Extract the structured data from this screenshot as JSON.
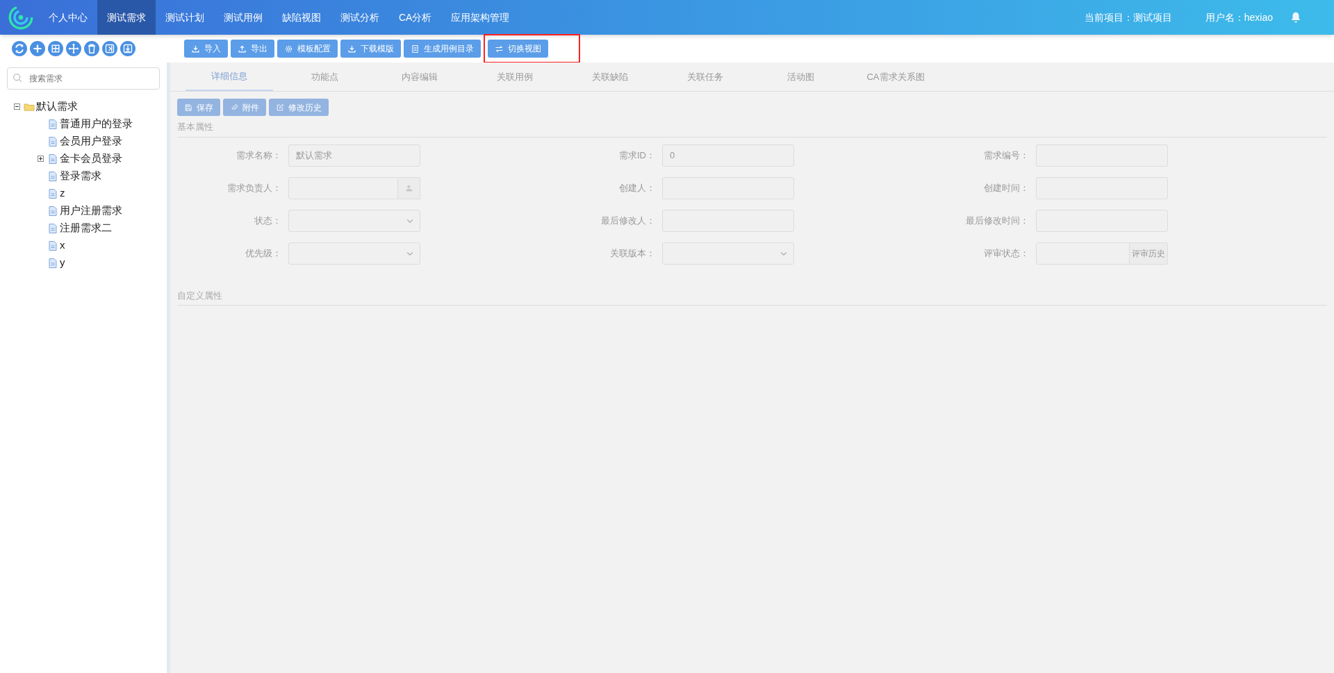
{
  "nav": {
    "items": [
      {
        "label": "个人中心",
        "selected": false
      },
      {
        "label": "测试需求",
        "selected": true
      },
      {
        "label": "测试计划",
        "selected": false
      },
      {
        "label": "测试用例",
        "selected": false
      },
      {
        "label": "缺陷视图",
        "selected": false
      },
      {
        "label": "测试分析",
        "selected": false
      },
      {
        "label": "CA分析",
        "selected": false
      },
      {
        "label": "应用架构管理",
        "selected": false
      }
    ],
    "project": "当前项目：测试项目",
    "user": "用户名：hexiao"
  },
  "tree_tools": [
    {
      "kind": "refresh"
    },
    {
      "kind": "add"
    },
    {
      "kind": "expand"
    },
    {
      "kind": "move"
    },
    {
      "kind": "delete"
    },
    {
      "kind": "collapse"
    },
    {
      "kind": "import"
    }
  ],
  "toolbar": [
    {
      "label": "导入",
      "kind": "download",
      "highlighted": false
    },
    {
      "label": "导出",
      "kind": "upload",
      "highlighted": false
    },
    {
      "label": "模板配置",
      "kind": "gear",
      "highlighted": false
    },
    {
      "label": "下载模版",
      "kind": "download",
      "highlighted": false
    },
    {
      "label": "生成用例目录",
      "kind": "document",
      "highlighted": false
    },
    {
      "label": "切换视图",
      "kind": "swap",
      "highlighted": true
    }
  ],
  "search": {
    "placeholder": "搜索需求"
  },
  "tree": [
    {
      "label": "默认需求",
      "kind": "folder",
      "expanded": true,
      "children": [
        {
          "label": "普通用户的登录",
          "kind": "file"
        },
        {
          "label": "会员用户登录",
          "kind": "file"
        },
        {
          "label": "金卡会员登录",
          "kind": "file",
          "expanded": false
        },
        {
          "label": "登录需求",
          "kind": "file"
        },
        {
          "label": "z",
          "kind": "file"
        },
        {
          "label": "用户注册需求",
          "kind": "file"
        },
        {
          "label": "注册需求二",
          "kind": "file"
        },
        {
          "label": "x",
          "kind": "file"
        },
        {
          "label": "y",
          "kind": "file"
        }
      ]
    }
  ],
  "detail": {
    "disabled": true,
    "tabs": [
      {
        "label": "详细信息",
        "selected": true
      },
      {
        "label": "功能点",
        "selected": false
      },
      {
        "label": "内容编辑",
        "selected": false
      },
      {
        "label": "关联用例",
        "selected": false
      },
      {
        "label": "关联缺陷",
        "selected": false
      },
      {
        "label": "关联任务",
        "selected": false
      },
      {
        "label": "活动图",
        "selected": false
      },
      {
        "label": "CA需求关系图",
        "selected": false
      }
    ],
    "actions": [
      {
        "label": "保存",
        "kind": "save"
      },
      {
        "label": "附件",
        "kind": "clip"
      },
      {
        "label": "修改历史",
        "kind": "edit"
      }
    ],
    "basic_title": "基本属性",
    "fields": [
      {
        "label": "需求名称：",
        "kind": "text",
        "value": "默认需求"
      },
      {
        "label": "需求ID：",
        "kind": "text",
        "value": "0"
      },
      {
        "label": "需求编号：",
        "kind": "text"
      },
      {
        "label": "需求负责人：",
        "kind": "picker"
      },
      {
        "label": "创建人：",
        "kind": "text"
      },
      {
        "label": "创建时间：",
        "kind": "text"
      },
      {
        "label": "状态：",
        "kind": "select"
      },
      {
        "label": "最后修改人：",
        "kind": "text"
      },
      {
        "label": "最后修改时间：",
        "kind": "text"
      },
      {
        "label": "优先级：",
        "kind": "select"
      },
      {
        "label": "关联版本：",
        "kind": "select"
      },
      {
        "label": "评审状态：",
        "kind": "button",
        "button": "评审历史"
      }
    ],
    "custom_title": "自定义属性"
  }
}
